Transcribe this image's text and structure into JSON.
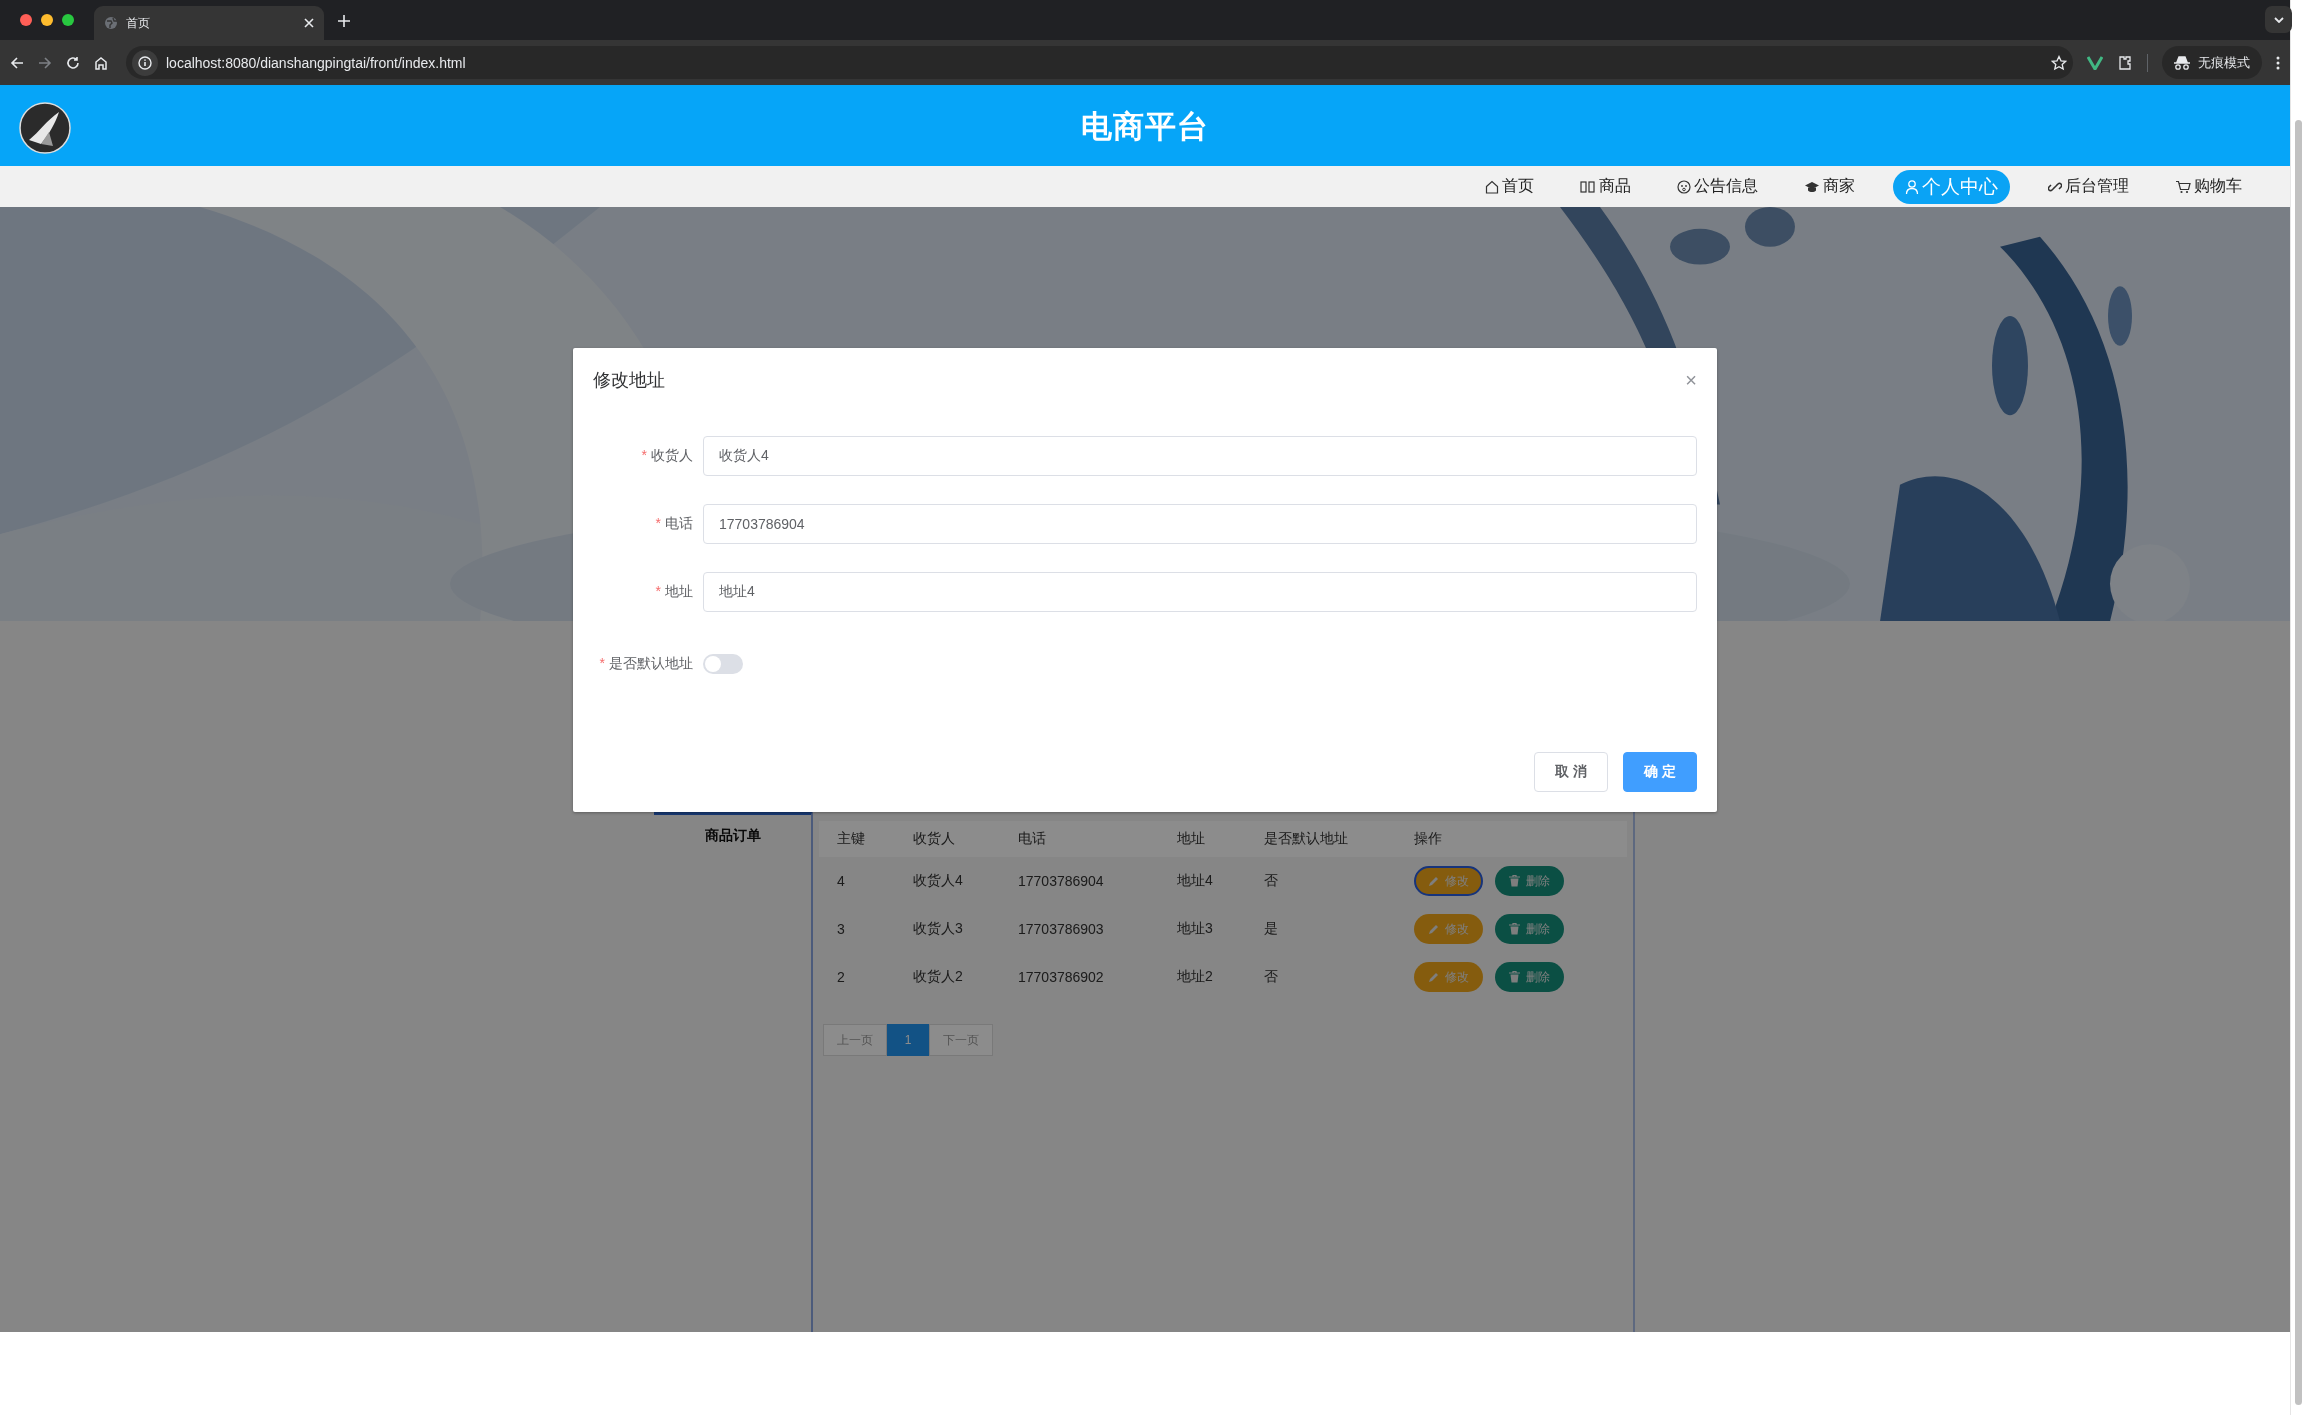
{
  "browser": {
    "tab_title": "首页",
    "url": "localhost:8080/dianshangpingtai/front/index.html",
    "profile_label": "无痕模式"
  },
  "header": {
    "title": "电商平台"
  },
  "nav": {
    "items": [
      {
        "label": "首页",
        "selected": false
      },
      {
        "label": "商品",
        "selected": false
      },
      {
        "label": "公告信息",
        "selected": false
      },
      {
        "label": "商家",
        "selected": false
      },
      {
        "label": "个人中心",
        "selected": true
      },
      {
        "label": "后台管理",
        "selected": false
      },
      {
        "label": "购物车",
        "selected": false
      }
    ]
  },
  "sidebar": {
    "items": [
      {
        "label": "商品订单"
      }
    ]
  },
  "table": {
    "columns": [
      "主键",
      "收货人",
      "电话",
      "地址",
      "是否默认地址",
      "操作"
    ],
    "rows": [
      {
        "cells": [
          "4",
          "收货人4",
          "17703786904",
          "地址4",
          "否"
        ],
        "edit_label": "修改",
        "delete_label": "删除",
        "edit_focused": true
      },
      {
        "cells": [
          "3",
          "收货人3",
          "17703786903",
          "地址3",
          "是"
        ],
        "edit_label": "修改",
        "delete_label": "删除",
        "edit_focused": false
      },
      {
        "cells": [
          "2",
          "收货人2",
          "17703786902",
          "地址2",
          "否"
        ],
        "edit_label": "修改",
        "delete_label": "删除",
        "edit_focused": false
      }
    ]
  },
  "pagination": {
    "prev": "上一页",
    "pages": [
      {
        "label": "1",
        "selected": true
      }
    ],
    "next": "下一页"
  },
  "dialog": {
    "title": "修改地址",
    "close": "×",
    "fields": [
      {
        "mark": "*",
        "label": "收货人",
        "value": "收货人4"
      },
      {
        "mark": "*",
        "label": "电话",
        "value": "17703786904"
      },
      {
        "mark": "*",
        "label": "地址",
        "value": "地址4"
      }
    ],
    "default_switch": {
      "mark": "*",
      "label": "是否默认地址",
      "on": false
    },
    "buttons": {
      "cancel": "取 消",
      "confirm": "确 定"
    }
  }
}
